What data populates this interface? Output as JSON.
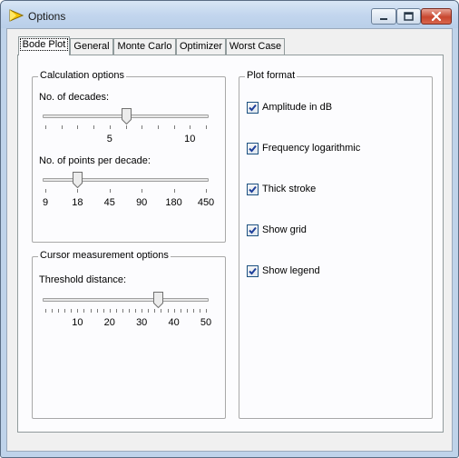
{
  "window": {
    "title": "Options"
  },
  "tabs": [
    {
      "label": "Bode Plot",
      "active": true
    },
    {
      "label": "General"
    },
    {
      "label": "Monte Carlo"
    },
    {
      "label": "Optimizer"
    },
    {
      "label": "Worst Case"
    }
  ],
  "calc": {
    "title": "Calculation options",
    "decades": {
      "label": "No. of decades:",
      "ticklabels": [
        "5",
        "10"
      ],
      "value": 6,
      "min": 1,
      "max": 11
    },
    "points": {
      "label": "No. of points per decade:",
      "ticklabels": [
        "9",
        "18",
        "45",
        "90",
        "180",
        "450"
      ],
      "selected_index": 1
    }
  },
  "cursor": {
    "title": "Cursor measurement options",
    "threshold": {
      "label": "Threshold distance:",
      "ticklabels": [
        "10",
        "20",
        "30",
        "40",
        "50"
      ],
      "value": 35,
      "min": 0,
      "max": 50
    }
  },
  "plot": {
    "title": "Plot format",
    "items": [
      {
        "label": "Amplitude in dB",
        "checked": true
      },
      {
        "label": "Frequency logarithmic",
        "checked": true
      },
      {
        "label": "Thick stroke",
        "checked": true
      },
      {
        "label": "Show grid",
        "checked": true
      },
      {
        "label": "Show legend",
        "checked": true
      }
    ]
  },
  "colors": {
    "titlebar": "#c3d6ee",
    "panel": "#fcfcfe",
    "check": "#1e3f9a"
  }
}
